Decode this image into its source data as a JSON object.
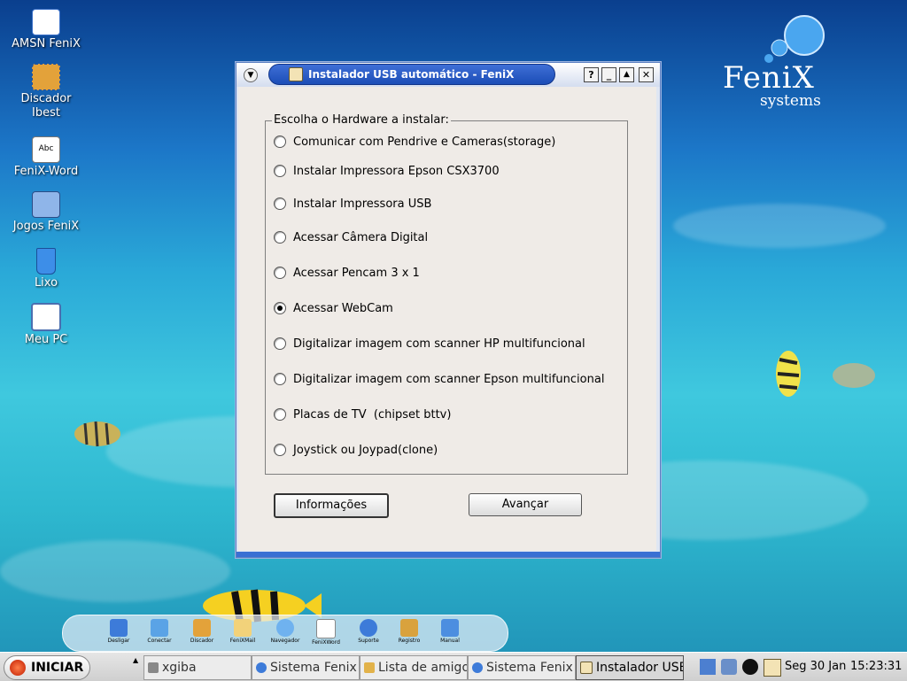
{
  "desktop": {
    "icons": [
      {
        "label": "AMSN FeniX",
        "icon": "amsn-icon"
      },
      {
        "label": "Discador Ibest",
        "icon": "dialer-icon"
      },
      {
        "label": "FeniX-Word",
        "icon": "word-processor-icon"
      },
      {
        "label": "Jogos FeniX",
        "icon": "games-icon"
      },
      {
        "label": "Lixo",
        "icon": "trash-icon"
      },
      {
        "label": "Meu PC",
        "icon": "computer-icon"
      }
    ],
    "logo": {
      "brand": "FeniX",
      "sub": "systems"
    }
  },
  "window": {
    "title": "Instalador USB automático - FeniX",
    "buttons": {
      "help": "?",
      "minimize": "_",
      "maximize": "▲",
      "close": "✕"
    },
    "group_title": "Escolha o Hardware a instalar:",
    "options": [
      {
        "label": "Comunicar com Pendrive e Cameras(storage)",
        "selected": false
      },
      {
        "label": "Instalar Impressora Epson CSX3700",
        "selected": false
      },
      {
        "label": "Instalar Impressora USB",
        "selected": false
      },
      {
        "label": "Acessar Câmera Digital",
        "selected": false
      },
      {
        "label": "Acessar Pencam 3 x 1",
        "selected": false
      },
      {
        "label": "Acessar WebCam",
        "selected": true
      },
      {
        "label": "Digitalizar imagem com scanner HP multifuncional",
        "selected": false
      },
      {
        "label": "Digitalizar imagem com scanner Epson multifuncional",
        "selected": false
      },
      {
        "label": "Placas de TV  (chipset bttv)",
        "selected": false
      },
      {
        "label": "Joystick ou Joypad(clone)",
        "selected": false
      }
    ],
    "info_button": "Informações",
    "next_button": "Avançar"
  },
  "dock": {
    "items": [
      "Desligar",
      "Conectar",
      "Discador",
      "FeniXMail",
      "Navegador",
      "FeniXWord",
      "Suporte",
      "Registro",
      "Manual"
    ]
  },
  "taskbar": {
    "start_label": "INICIAR",
    "tasks": [
      {
        "label": "xgiba",
        "active": false
      },
      {
        "label": "Sistema Fenix",
        "active": false
      },
      {
        "label": "Lista de amigos",
        "active": false
      },
      {
        "label": "Sistema Fenix",
        "active": false
      },
      {
        "label": "Instalador USB",
        "active": true
      }
    ],
    "date": "Seg 30 Jan",
    "time": "15:23:31"
  },
  "colors": {
    "title_bar": "#2a5bc8",
    "window_bg": "#efebe7",
    "desktop_water": "#3fc8de"
  }
}
